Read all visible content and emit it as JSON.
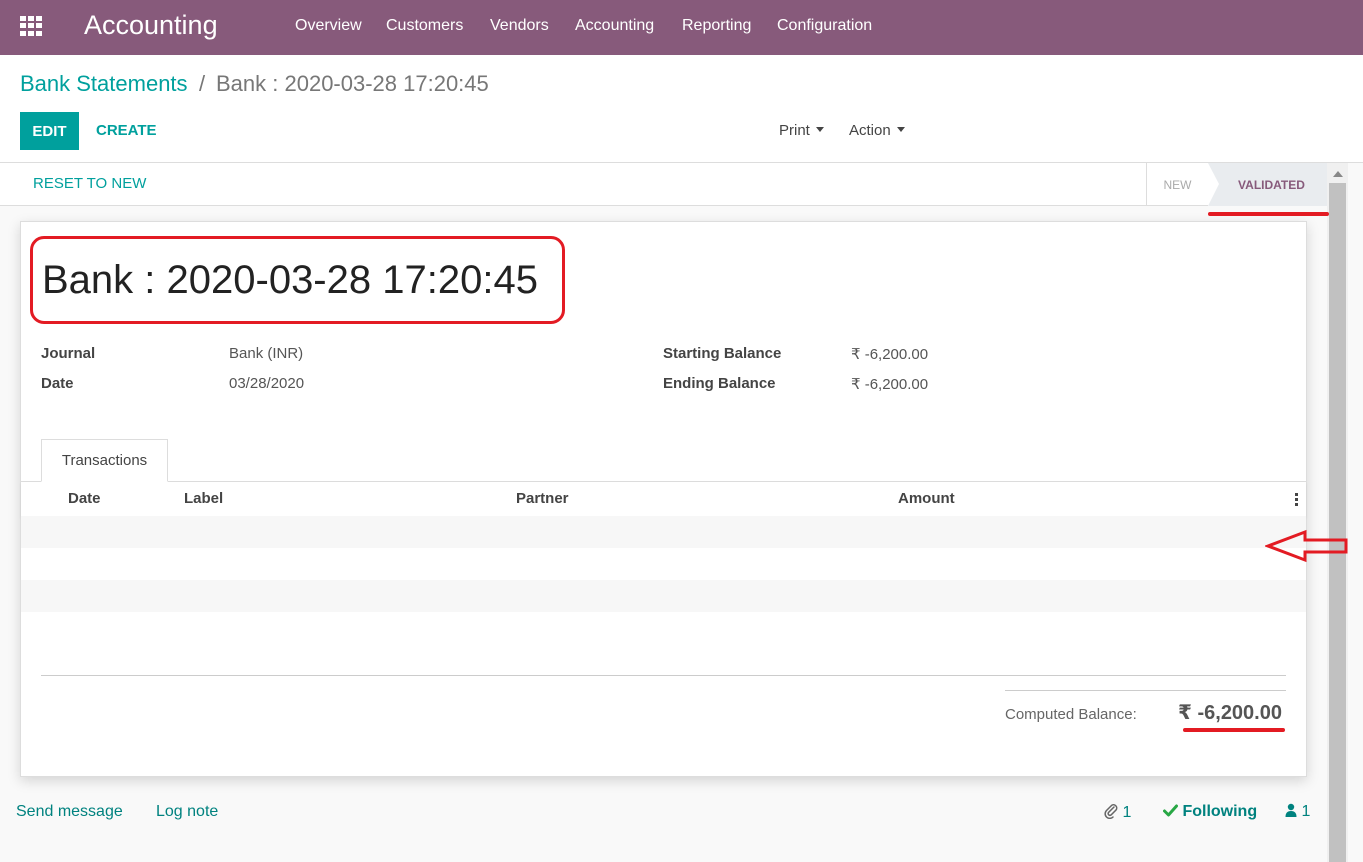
{
  "app": {
    "title": "Accounting",
    "nav": [
      "Overview",
      "Customers",
      "Vendors",
      "Accounting",
      "Reporting",
      "Configuration"
    ]
  },
  "breadcrumb": {
    "parent": "Bank Statements",
    "separator": "/",
    "current": "Bank : 2020-03-28 17:20:45"
  },
  "toolbar": {
    "edit": "EDIT",
    "create": "CREATE",
    "print": "Print",
    "action": "Action"
  },
  "statusbar": {
    "reset": "RESET TO NEW",
    "stages": [
      "NEW",
      "VALIDATED"
    ],
    "active_stage": "VALIDATED"
  },
  "record": {
    "title": "Bank : 2020-03-28 17:20:45",
    "journal_label": "Journal",
    "journal_value": "Bank (INR)",
    "date_label": "Date",
    "date_value": "03/28/2020",
    "starting_balance_label": "Starting Balance",
    "starting_balance_value": "₹ -6,200.00",
    "ending_balance_label": "Ending Balance",
    "ending_balance_value": "₹ -6,200.00"
  },
  "tabs": [
    "Transactions"
  ],
  "table": {
    "columns": [
      "Date",
      "Label",
      "Partner",
      "Amount"
    ],
    "rows": []
  },
  "totals": {
    "computed_balance_label": "Computed Balance:",
    "computed_balance_value": "₹ -6,200.00"
  },
  "chatter": {
    "send_message": "Send message",
    "log_note": "Log note",
    "attachments": "1",
    "following": "Following",
    "followers": "1"
  },
  "colors": {
    "brand": "#875a7b",
    "accent": "#00a09d",
    "annotation": "#e31b23"
  }
}
